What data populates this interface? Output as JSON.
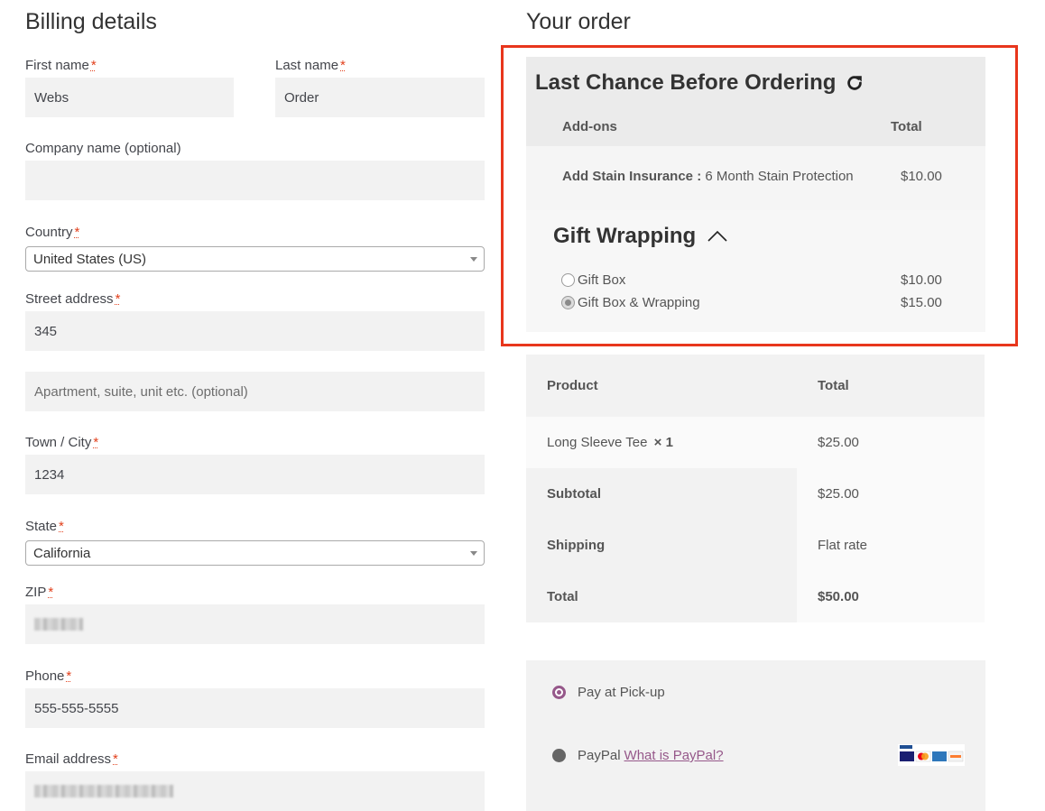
{
  "billing": {
    "title": "Billing details",
    "required_mark": "*",
    "first_name": {
      "label": "First name",
      "value": "Webs"
    },
    "last_name": {
      "label": "Last name",
      "value": "Order"
    },
    "company": {
      "label": "Company name (optional)",
      "value": ""
    },
    "country": {
      "label": "Country",
      "value": "United States (US)"
    },
    "street": {
      "label": "Street address",
      "value": "345",
      "apartment_placeholder": "Apartment, suite, unit etc. (optional)"
    },
    "city": {
      "label": "Town / City",
      "value": "1234"
    },
    "state": {
      "label": "State",
      "value": "California"
    },
    "zip": {
      "label": "ZIP"
    },
    "phone": {
      "label": "Phone",
      "value": "555-555-5555"
    },
    "email": {
      "label": "Email address"
    }
  },
  "order": {
    "title": "Your order",
    "addons": {
      "title": "Last Chance Before Ordering",
      "refresh_icon": "refresh-icon",
      "col_addons": "Add-ons",
      "col_total": "Total",
      "insurance_label": "Add Stain Insurance :",
      "insurance_option": "6 Month Stain Protection",
      "insurance_price": "$10.00",
      "gift_title": "Gift Wrapping",
      "gift_toggle_icon": "chevron-up-icon",
      "gift_options": [
        {
          "label": "Gift Box",
          "price": "$10.00",
          "selected": false
        },
        {
          "label": "Gift Box & Wrapping",
          "price": "$15.00",
          "selected": true
        }
      ]
    },
    "table": {
      "col_product": "Product",
      "col_total": "Total",
      "item_name": "Long Sleeve Tee",
      "item_qty": "× 1",
      "item_total": "$25.00",
      "subtotal_label": "Subtotal",
      "subtotal_value": "$25.00",
      "shipping_label": "Shipping",
      "shipping_value": "Flat rate",
      "total_label": "Total",
      "total_value": "$50.00"
    },
    "payment": {
      "option1": "Pay at Pick-up",
      "option2": "PayPal",
      "paypal_link": "What is PayPal?",
      "selected": "Pay at Pick-up"
    }
  },
  "colors": {
    "accent": "#96588a",
    "required": "#e2401c",
    "highlight": "#e8361c"
  }
}
